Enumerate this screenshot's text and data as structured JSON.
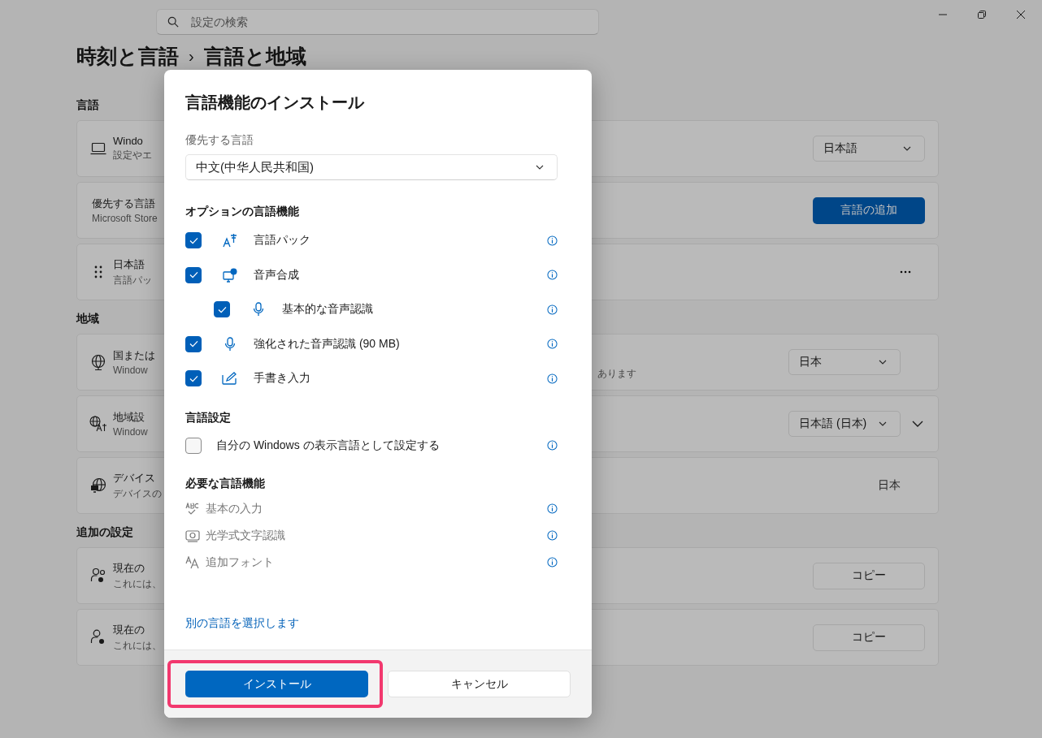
{
  "search": {
    "placeholder": "設定の検索"
  },
  "breadcrumb": {
    "parent": "時刻と言語",
    "separator": "›",
    "current": "言語と地域"
  },
  "sections": [
    {
      "title": "言語",
      "rows": [
        {
          "title": "Windo",
          "subtitle": "設定やエ",
          "control": {
            "kind": "dropdown",
            "value": "日本語"
          }
        },
        {
          "title": "優先する言語",
          "subtitle": "Microsoft Store",
          "control": {
            "kind": "accent-button",
            "value": "言語の追加"
          }
        },
        {
          "title": "日本語",
          "subtitle": "言語パッ",
          "control": {
            "kind": "more"
          }
        }
      ]
    },
    {
      "title": "地域",
      "rows": [
        {
          "title": "国または",
          "subtitle": "Window",
          "subtitle_tail": "あります",
          "control": {
            "kind": "dropdown",
            "value": "日本"
          }
        },
        {
          "title": "地域設",
          "subtitle": "Window",
          "expanded": false,
          "control": {
            "kind": "dropdown",
            "value": "日本語 (日本)"
          }
        },
        {
          "title": "デバイス",
          "subtitle": "デバイスの",
          "control": {
            "kind": "text",
            "value": "日本"
          }
        }
      ]
    },
    {
      "title": "追加の設定",
      "rows": [
        {
          "title": "現在の",
          "subtitle": "これには、",
          "control": {
            "kind": "button",
            "value": "コピー"
          }
        },
        {
          "title": "現在の",
          "subtitle": "これには、",
          "control": {
            "kind": "button",
            "value": "コピー"
          }
        }
      ]
    }
  ],
  "dialog": {
    "title": "言語機能のインストール",
    "preferred_label": "優先する言語",
    "preferred_value": "中文(中华人民共和国)",
    "optional": {
      "heading": "オプションの言語機能",
      "items": [
        {
          "label": "言語パック",
          "checked": true
        },
        {
          "label": "音声合成",
          "checked": true,
          "children": [
            {
              "label": "基本的な音声認識",
              "checked": true
            }
          ]
        },
        {
          "label": "強化された音声認識 (90 MB)",
          "checked": true
        },
        {
          "label": "手書き入力",
          "checked": true
        }
      ]
    },
    "settings": {
      "heading": "言語設定",
      "items": [
        {
          "label": "自分の Windows の表示言語として設定する",
          "checked": false
        }
      ]
    },
    "required": {
      "heading": "必要な言語機能",
      "items": [
        "基本の入力",
        "光学式文字認識",
        "追加フォント"
      ]
    },
    "link": "別の言語を選択します",
    "buttons": [
      {
        "label": "インストール",
        "kind": "primary",
        "highlighted": true
      },
      {
        "label": "キャンセル",
        "kind": "secondary",
        "highlighted": false
      }
    ]
  }
}
